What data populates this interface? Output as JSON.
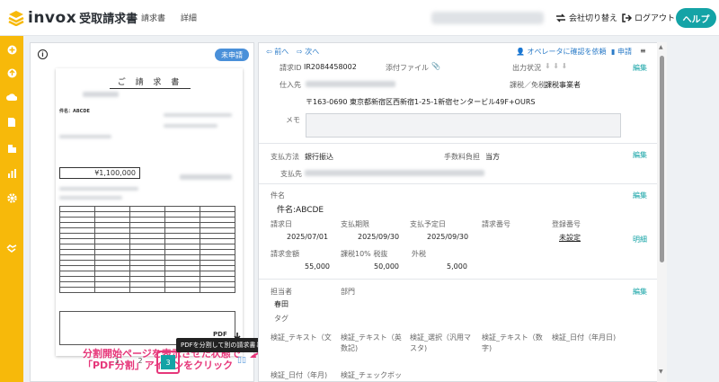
{
  "app": {
    "name": "invox",
    "subtitle": "受取請求書"
  },
  "breadcrumb": [
    "請求書",
    "詳細"
  ],
  "header": {
    "switch_company": "会社切り替え",
    "logout": "ログアウト",
    "help": "ヘルプ"
  },
  "sidebar": {
    "icons": [
      "plus-icon",
      "upload-icon",
      "cloud-upload-icon",
      "document-icon",
      "building-icon",
      "chart-icon",
      "gear-icon",
      "handshake-icon"
    ]
  },
  "preview": {
    "status_badge": "未申請",
    "doc_title": "ご 請 求 書",
    "subject_line": "件名：ABCDE",
    "amount": "¥1,100,000",
    "callout_line1": "分割開始ページを表示させた状態で",
    "callout_line2": "「PDF分割」アイコンをクリック",
    "tooltip": "PDFを分割して別の請求書として登録します。",
    "pages": [
      "1",
      "2",
      "3"
    ],
    "pdf_label": "PDF"
  },
  "toolbar": {
    "prev": "前へ",
    "next": "次へ",
    "confirm_operator": "オペレータに確認を依頼",
    "apply": "申請"
  },
  "detail": {
    "request_id_label": "請求ID",
    "request_id": "IR2084458002",
    "attachment_label": "添付ファイル",
    "output_status_label": "出力状況",
    "edit": "編集",
    "supplier_label": "仕入先",
    "tax_label": "課税／免税",
    "tax_value": "課税事業者",
    "address": "〒163-0690 東京都新宿区西新宿1-25-1新宿センタービル49F+OURS",
    "memo_label": "メモ",
    "payment_method_label": "支払方法",
    "payment_method": "銀行振込",
    "fee_label": "手数料負担",
    "fee_value": "当方",
    "payee_label": "支払先",
    "subject_label": "件名",
    "subject_value": "件名:ABCDE",
    "invoice_date_label": "請求日",
    "invoice_date": "2025/07/01",
    "due_date_label": "支払期限",
    "due_date": "2025/09/30",
    "planned_date_label": "支払予定日",
    "planned_date": "2025/09/30",
    "invoice_no_label": "請求番号",
    "reg_no_label": "登録番号",
    "reg_no_value": "未設定",
    "detail_link": "明細",
    "amount_label": "請求金額",
    "amount": "55,000",
    "tax10_label": "課税10% 税抜",
    "tax10": "50,000",
    "outside_label": "外税",
    "outside": "5,000",
    "assignee_label": "担当者",
    "assignee": "春田",
    "dept_label": "部門",
    "tag_label": "タグ",
    "custom1": "検証_テキスト（文",
    "custom2": "検証_テキスト（英\n数記)",
    "custom3": "検証_選択（汎用マ\nスタ)",
    "custom4": "検証_テキスト（数\n字)",
    "custom5": "検証_日付（年月日)",
    "custom6": "検証_日付（年月)",
    "custom7": "検証_チェックボッ"
  },
  "colors": {
    "accent": "#14a3a6",
    "sidebar": "#f7b90a",
    "highlight": "#e6377a",
    "badge": "#4a90d9"
  }
}
